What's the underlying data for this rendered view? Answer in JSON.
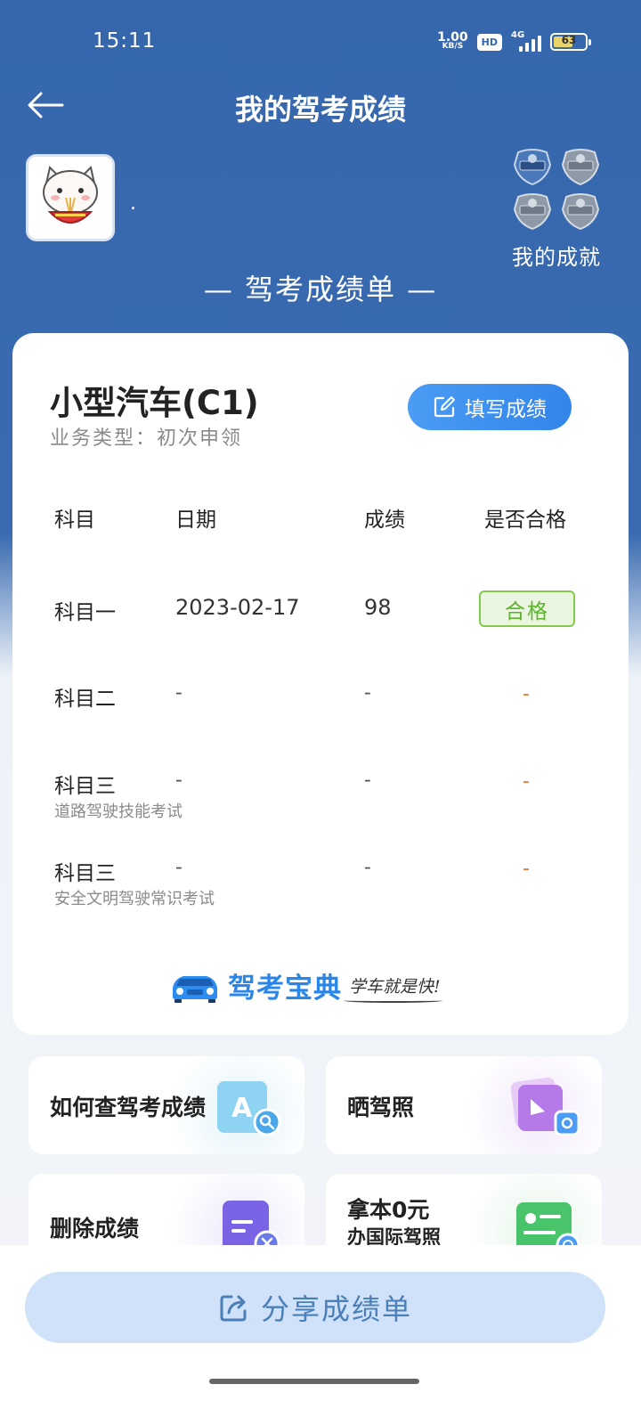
{
  "status": {
    "time": "15:11",
    "net_speed": "1.00",
    "net_unit": "KB/S",
    "hd": "HD",
    "network": "4G",
    "battery": "63",
    "battery_level": 0.63
  },
  "header": {
    "title": "我的驾考成绩"
  },
  "profile": {
    "username": "."
  },
  "achievements": {
    "label": "我的成就"
  },
  "section_title": "— 驾考成绩单 —",
  "card": {
    "car_type": "小型汽车(C1)",
    "business_type": "业务类型：初次申领",
    "fill_button": "填写成绩",
    "columns": {
      "subject": "科目",
      "date": "日期",
      "score": "成绩",
      "pass": "是否合格"
    },
    "rows": [
      {
        "subject": "科目一",
        "note": "",
        "date": "2023-02-17",
        "score": "98",
        "result": "合格"
      },
      {
        "subject": "科目二",
        "note": "",
        "date": "-",
        "score": "-",
        "result": "-"
      },
      {
        "subject": "科目三",
        "note": "道路驾驶技能考试",
        "date": "-",
        "score": "-",
        "result": "-"
      },
      {
        "subject": "科目三",
        "note": "安全文明驾驶常识考试",
        "date": "-",
        "score": "-",
        "result": "-"
      }
    ],
    "brand_name": "驾考宝典",
    "brand_slogan": "学车就是快!"
  },
  "tiles": [
    {
      "label": "如何查驾考成绩"
    },
    {
      "label": "晒驾照"
    },
    {
      "label": "删除成绩"
    },
    {
      "label_line1": "拿本0元",
      "label_line2": "办国际驾照"
    }
  ],
  "share_button": "分享成绩单",
  "colors": {
    "header_blue": "#3667ad",
    "pass_green": "#5ab32a",
    "accent_blue": "#2a86e8",
    "dash_orange": "#e07a3a"
  }
}
